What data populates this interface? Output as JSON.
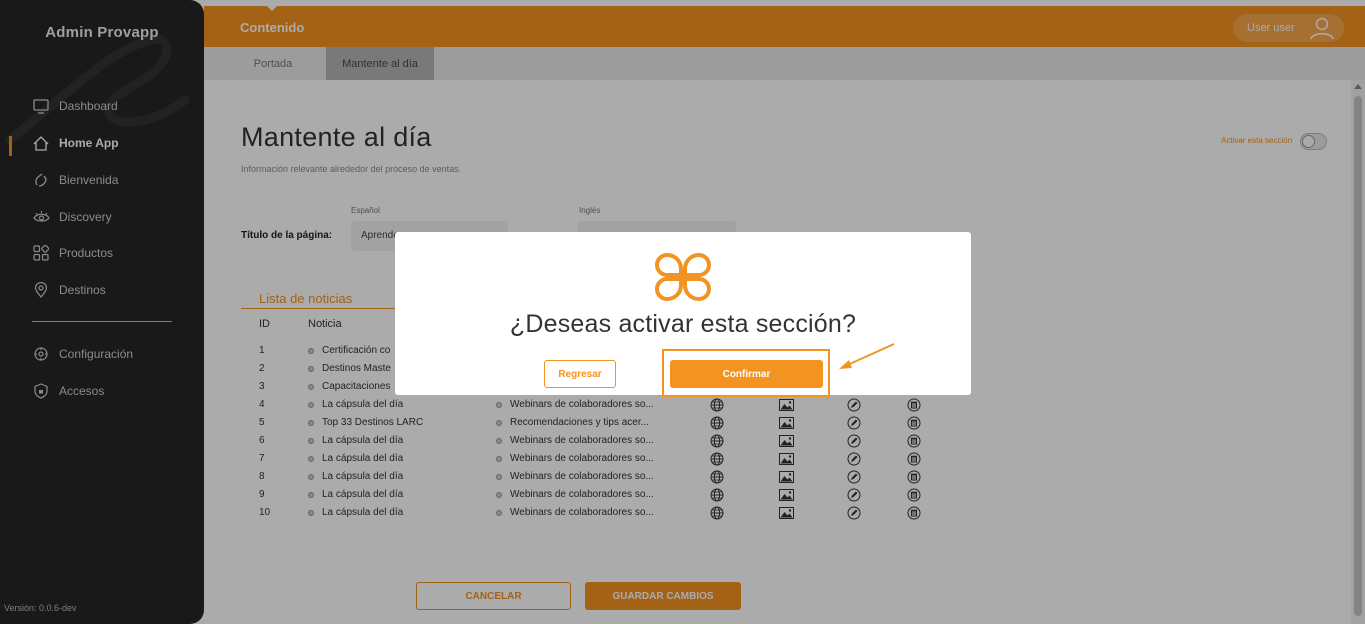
{
  "sidebar": {
    "brand": "Admin Provapp",
    "items": [
      {
        "label": "Dashboard",
        "icon": "monitor-icon"
      },
      {
        "label": "Home App",
        "icon": "home-icon",
        "active": true
      },
      {
        "label": "Bienvenida",
        "icon": "hand-wave-icon"
      },
      {
        "label": "Discovery",
        "icon": "eye-icon"
      },
      {
        "label": "Productos",
        "icon": "grid-icon"
      },
      {
        "label": "Destinos",
        "icon": "map-pin-icon"
      },
      {
        "label": "Configuración",
        "icon": "gear-icon"
      },
      {
        "label": "Accesos",
        "icon": "shield-icon"
      }
    ],
    "version": "Versión: 0.0.6-dev"
  },
  "header": {
    "section": "Contenido",
    "user": "User user"
  },
  "tabs": [
    {
      "label": "Portada"
    },
    {
      "label": "Mantente al día",
      "selected": true
    }
  ],
  "page": {
    "title": "Mantente al día",
    "subtitle": "Información relevante alrededor del proceso de ventas.",
    "activate_label": "Activar esta sección",
    "lang_es": "Español",
    "lang_en": "Inglés",
    "title_label": "Título de la página:",
    "title_es_value": "Aprende"
  },
  "news": {
    "list_title": "Lista de noticias",
    "headers": {
      "id": "ID",
      "news": "Noticia"
    },
    "rows": [
      {
        "id": "1",
        "news": "Certificación co",
        "category": ""
      },
      {
        "id": "2",
        "news": "Destinos Maste",
        "category": ""
      },
      {
        "id": "3",
        "news": "Capacitaciones",
        "category": ""
      },
      {
        "id": "4",
        "news": "La cápsula del día",
        "category": "Webinars de colaboradores so..."
      },
      {
        "id": "5",
        "news": "Top 33 Destinos LARC",
        "category": "Recomendaciones y tips acer..."
      },
      {
        "id": "6",
        "news": "La cápsula del día",
        "category": "Webinars de colaboradores so..."
      },
      {
        "id": "7",
        "news": "La cápsula del día",
        "category": "Webinars de colaboradores so..."
      },
      {
        "id": "8",
        "news": "La cápsula del día",
        "category": "Webinars de colaboradores so..."
      },
      {
        "id": "9",
        "news": "La cápsula del día",
        "category": "Webinars de colaboradores so..."
      },
      {
        "id": "10",
        "news": "La cápsula del día",
        "category": "Webinars de colaboradores so..."
      }
    ]
  },
  "actions": {
    "cancel": "CANCELAR",
    "save": "GUARDAR CAMBIOS"
  },
  "modal": {
    "question": "¿Deseas activar esta sección?",
    "back": "Regresar",
    "confirm": "Confirmar"
  },
  "colors": {
    "accent": "#f39322",
    "sidebar": "#262626"
  }
}
